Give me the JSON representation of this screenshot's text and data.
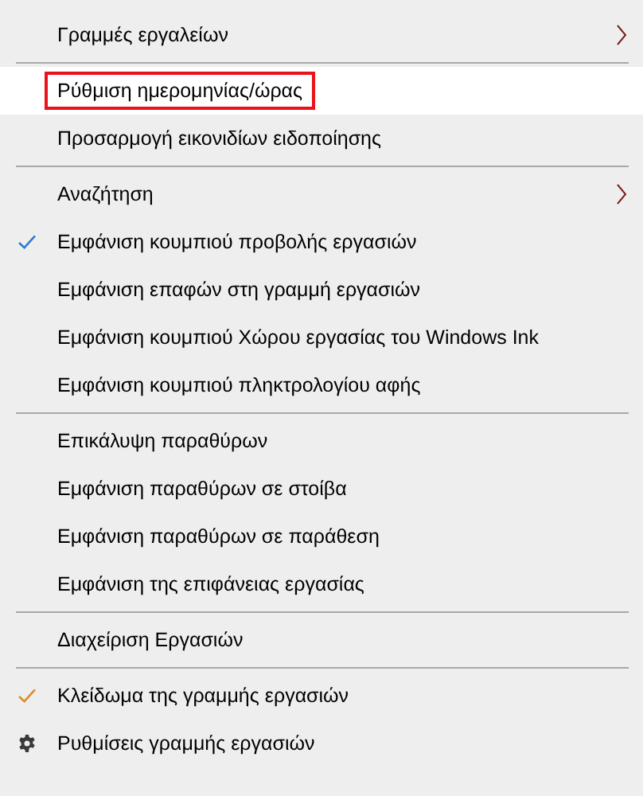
{
  "menu": {
    "groups": [
      [
        {
          "label": "Γραμμές εργαλείων",
          "submenu": true
        }
      ],
      [
        {
          "label": "Ρύθμιση ημερομηνίας/ώρας",
          "highlighted": true
        },
        {
          "label": "Προσαρμογή εικονιδίων ειδοποίησης"
        }
      ],
      [
        {
          "label": "Αναζήτηση",
          "submenu": true
        },
        {
          "label": "Εμφάνιση κουμπιού προβολής εργασιών",
          "checked": true,
          "color": "#2b7bd3"
        },
        {
          "label": "Εμφάνιση επαφών στη γραμμή εργασιών"
        },
        {
          "label": "Εμφάνιση κουμπιού Χώρου εργασίας του Windows Ink"
        },
        {
          "label": "Εμφάνιση κουμπιού πληκτρολογίου αφής"
        }
      ],
      [
        {
          "label": "Επικάλυψη παραθύρων"
        },
        {
          "label": "Εμφάνιση παραθύρων σε στοίβα"
        },
        {
          "label": "Εμφάνιση παραθύρων σε παράθεση"
        },
        {
          "label": "Εμφάνιση της επιφάνειας εργασίας"
        }
      ],
      [
        {
          "label": "Διαχείριση Εργασιών"
        }
      ],
      [
        {
          "label": "Κλείδωμα της γραμμής εργασιών",
          "checked": true,
          "color": "#e0892b"
        },
        {
          "label": "Ρυθμίσεις γραμμής εργασιών",
          "kind": "settings"
        }
      ]
    ]
  }
}
